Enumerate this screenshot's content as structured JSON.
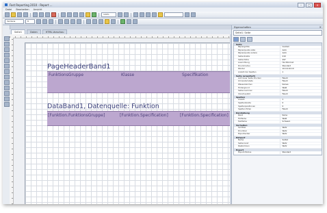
{
  "window": {
    "title": "Fast Reporting 2010 - Report ..."
  },
  "menu": {
    "items": [
      "Datei",
      "Bearbeiten",
      "Ansicht"
    ]
  },
  "toolbar": {
    "zoom": "100%",
    "font": "Verdana",
    "size": "8"
  },
  "tabs": [
    "Seite1",
    "Daten",
    "HTML-Vorschau"
  ],
  "report": {
    "page_header_title": "PageHeaderBand1",
    "columns": [
      "FunktionsGruppe",
      "Klasse",
      "Specifikation"
    ],
    "data_band_title": "DataBand1, Datenquelle: Funktion",
    "data_fields": [
      "[Funktion.FunktionsGruppe]",
      "[Funktion.Specification]",
      "[Funktion.Specification]"
    ]
  },
  "properties": {
    "title": "Eigenschaften",
    "selected": "Seite1: Seite",
    "sections": [
      {
        "name": "Seite",
        "rows": [
          [
            "Papiergröße",
            "Custom"
          ],
          [
            "Papierquelle erste",
            "Auto"
          ],
          [
            "Papierquelle andere",
            "Auto"
          ],
          [
            "Seitenbreite",
            "210"
          ],
          [
            "Seitenhöhe",
            "297"
          ],
          [
            "Ausrichtung",
            "Hochformat"
          ],
          [
            "Druckmodus",
            "Standard"
          ],
          [
            "Ränder",
            "10;10;10;10"
          ],
          [
            "Anzahl der Spalten",
            "1"
          ]
        ]
      },
      {
        "name": "Seite (erweitert)",
        "rows": [
          [
            "Auf neuer Seite drucken",
            "Falsch"
          ],
          [
            "Umrandet stets",
            "Falsch"
          ],
          [
            "Wasserzeichen",
            "Keines"
          ],
          [
            "Hintergrund",
            "Weiß"
          ],
          [
            "Seitennummer",
            "Falsch"
          ],
          [
            "Vorschaubild",
            "Falsch"
          ]
        ]
      },
      {
        "name": "Spalten",
        "rows": [
          [
            "Anzahl",
            "1"
          ],
          [
            "Spaltenbreite",
            "0"
          ],
          [
            "Spaltenpositionen",
            "0"
          ],
          [
            "Spalten füllen",
            "Falsch"
          ]
        ]
      },
      {
        "name": "Darstellung",
        "rows": [
          [
            "Rand",
            "Keine"
          ],
          [
            "Füllfarbe",
            "Weiß"
          ],
          [
            "Textfarbe",
            "Schwarz"
          ]
        ]
      },
      {
        "name": "Verhalten",
        "rows": [
          [
            "Sichtbar",
            "Wahr"
          ],
          [
            "Druckbar",
            "Wahr"
          ],
          [
            "Exportierbar",
            "Wahr"
          ]
        ]
      },
      {
        "name": "Entwurf",
        "rows": [
          [
            "Name",
            "Seite1"
          ],
          [
            "Seitenrand",
            "Wahr"
          ],
          [
            "Rasterlinien",
            "Wahr"
          ]
        ]
      },
      {
        "name": "Export",
        "rows": [
          [
            "Export-Modus",
            "Standard"
          ]
        ]
      }
    ]
  }
}
